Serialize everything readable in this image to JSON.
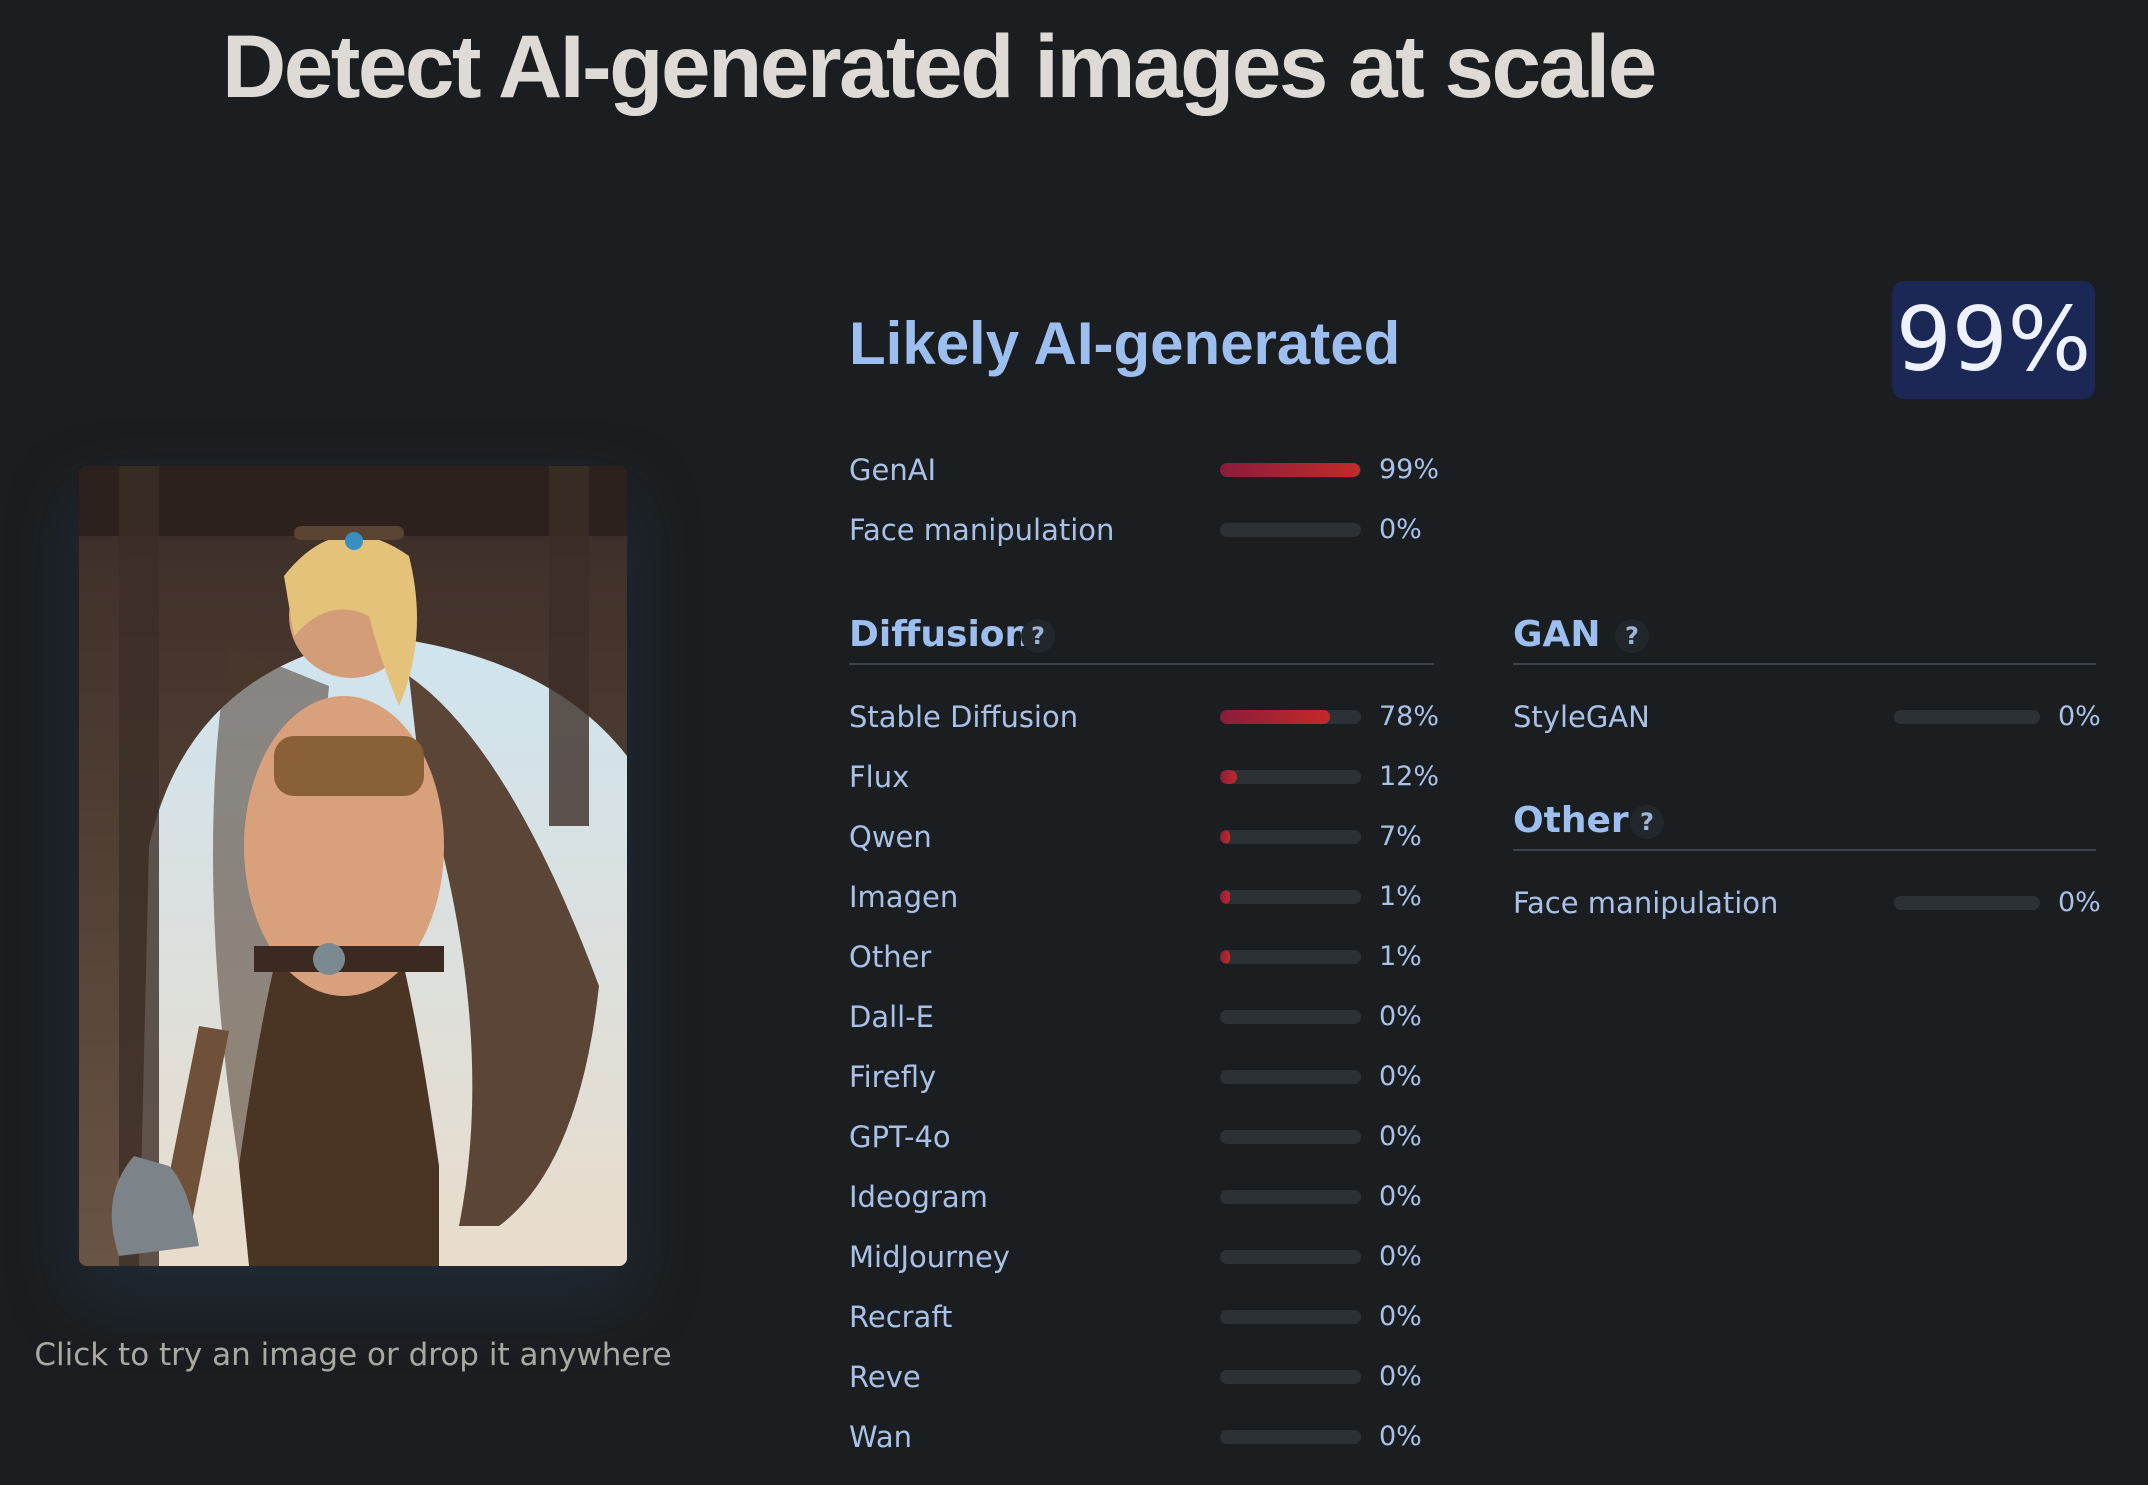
{
  "headline": "Detect AI-generated images at scale",
  "hint": "Click to try an image or drop it anywhere",
  "verdict": "Likely AI-generated",
  "score": "99%",
  "colors": {
    "background": "#1b1e20",
    "accent": "#9dbff0",
    "bar_fill": "#c32a2a",
    "badge": "#1b2856"
  },
  "summary": [
    {
      "label": "GenAI",
      "value": 0.99,
      "pct": "99%"
    },
    {
      "label": "Face manipulation",
      "value": 0.0,
      "pct": "0%"
    }
  ],
  "diffusion": {
    "title": "Diffusion",
    "help": "?",
    "items": [
      {
        "label": "Stable Diffusion",
        "value": 0.78,
        "pct": "78%"
      },
      {
        "label": "Flux",
        "value": 0.12,
        "pct": "12%"
      },
      {
        "label": "Qwen",
        "value": 0.07,
        "pct": "7%"
      },
      {
        "label": "Imagen",
        "value": 0.01,
        "pct": "1%"
      },
      {
        "label": "Other",
        "value": 0.01,
        "pct": "1%"
      },
      {
        "label": "Dall-E",
        "value": 0.0,
        "pct": "0%"
      },
      {
        "label": "Firefly",
        "value": 0.0,
        "pct": "0%"
      },
      {
        "label": "GPT-4o",
        "value": 0.0,
        "pct": "0%"
      },
      {
        "label": "Ideogram",
        "value": 0.0,
        "pct": "0%"
      },
      {
        "label": "MidJourney",
        "value": 0.0,
        "pct": "0%"
      },
      {
        "label": "Recraft",
        "value": 0.0,
        "pct": "0%"
      },
      {
        "label": "Reve",
        "value": 0.0,
        "pct": "0%"
      },
      {
        "label": "Wan",
        "value": 0.0,
        "pct": "0%"
      }
    ]
  },
  "gan": {
    "title": "GAN",
    "help": "?",
    "items": [
      {
        "label": "StyleGAN",
        "value": 0.0,
        "pct": "0%"
      }
    ]
  },
  "other": {
    "title": "Other",
    "help": "?",
    "items": [
      {
        "label": "Face manipulation",
        "value": 0.0,
        "pct": "0%"
      }
    ]
  }
}
